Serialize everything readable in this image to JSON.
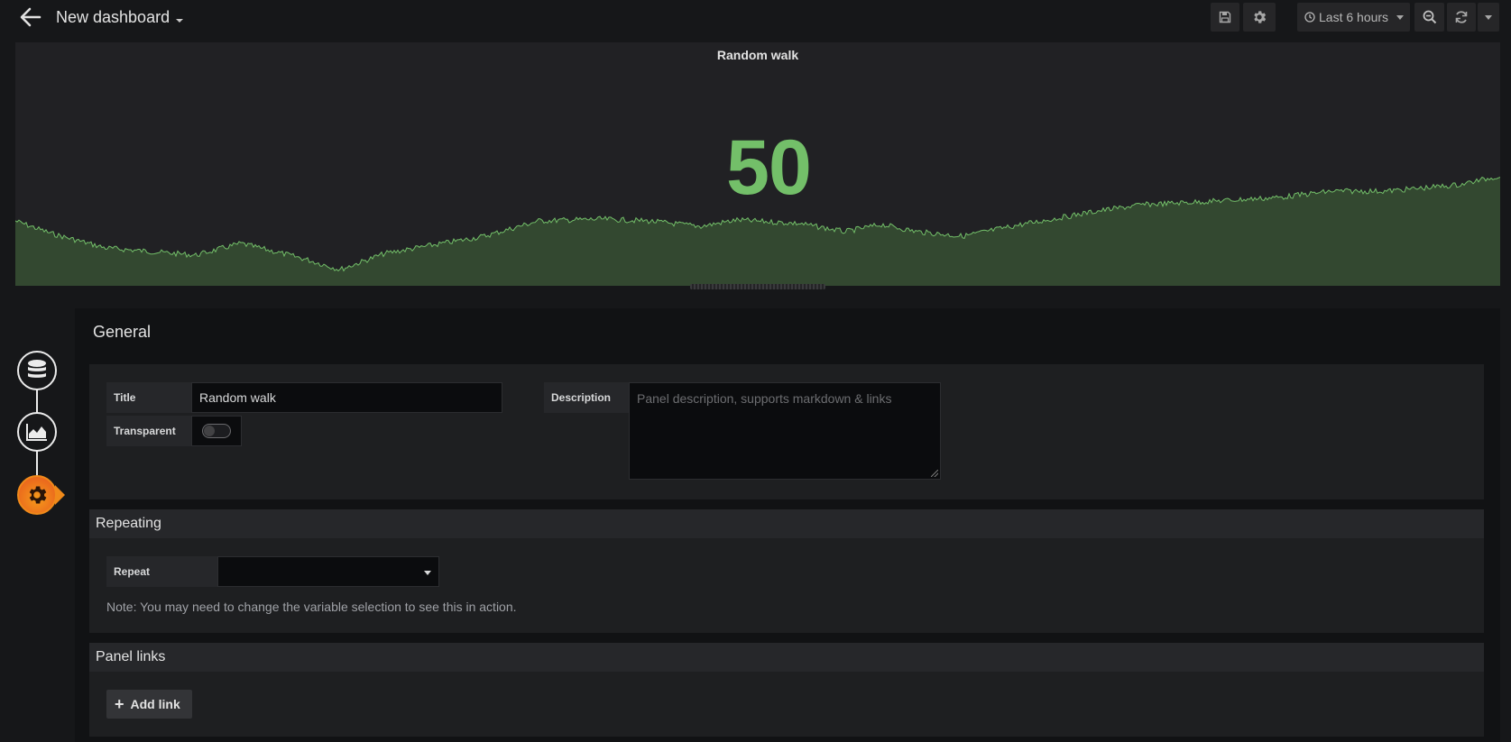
{
  "header": {
    "back_icon": "arrow-left-icon",
    "dashboard_title": "New dashboard",
    "save_icon": "save-icon",
    "settings_icon": "gear-icon",
    "time_picker_label": "Last 6 hours",
    "clock_icon": "clock-icon",
    "zoom_icon": "zoom-out-icon",
    "refresh_icon": "refresh-icon"
  },
  "panel": {
    "title": "Random walk",
    "value": "50",
    "value_color": "#73bf69"
  },
  "sidebar": {
    "steps": [
      {
        "name": "queries",
        "icon": "database-icon",
        "active": false
      },
      {
        "name": "visualization",
        "icon": "area-chart-icon",
        "active": false
      },
      {
        "name": "general",
        "icon": "gear-icon",
        "active": true
      }
    ]
  },
  "general": {
    "heading": "General",
    "title_label": "Title",
    "title_value": "Random walk",
    "transparent_label": "Transparent",
    "transparent_on": false,
    "description_label": "Description",
    "description_placeholder": "Panel description, supports markdown & links"
  },
  "repeating": {
    "heading": "Repeating",
    "repeat_label": "Repeat",
    "repeat_value": "",
    "note": "Note: You may need to change the variable selection to see this in action."
  },
  "panel_links": {
    "heading": "Panel links",
    "add_link_label": "Add link"
  },
  "colors": {
    "background": "#161719",
    "accent_orange": "#f08a1a",
    "series_green": "#73bf69"
  }
}
